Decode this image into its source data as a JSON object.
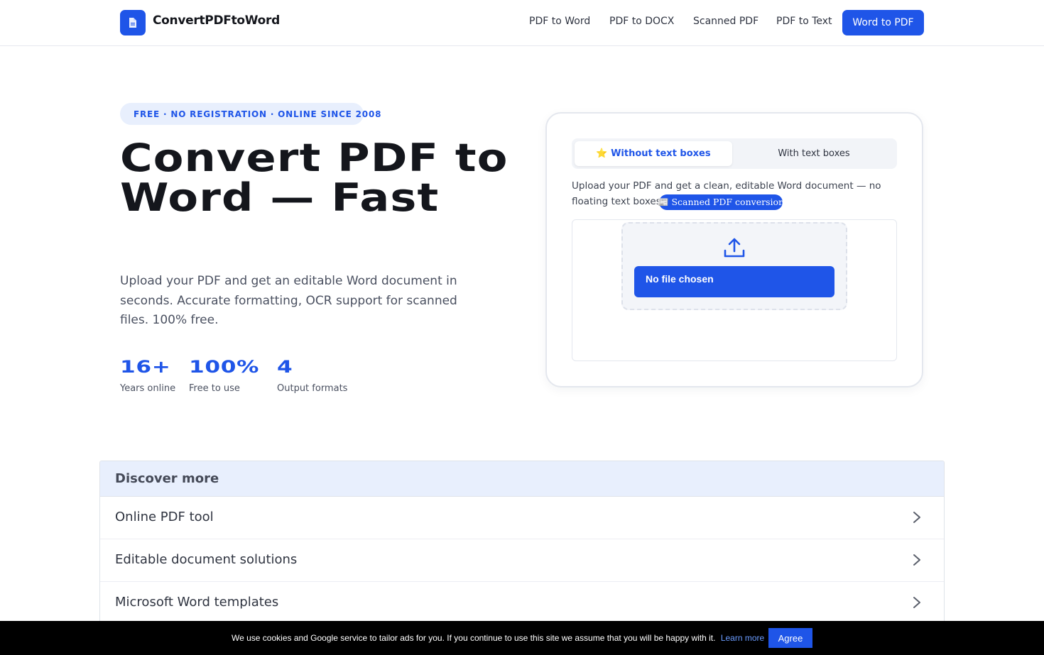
{
  "header": {
    "brand": "ConvertPDFtoWord",
    "logo_icon": "document-icon",
    "nav": [
      "PDF to Word",
      "PDF to DOCX",
      "Scanned PDF",
      "PDF to Text"
    ],
    "cta": "Word to PDF"
  },
  "hero": {
    "badge": "FREE · NO REGISTRATION · ONLINE SINCE 2008",
    "title": "Convert PDF to Word — Fast",
    "subtitle": "Upload your PDF and get an editable Word document in seconds. Accurate formatting, OCR support for scanned files. 100% free.",
    "stats": [
      {
        "value": "16+",
        "label": "Years online"
      },
      {
        "value": "100%",
        "label": "Free to use"
      },
      {
        "value": "4",
        "label": "Output formats"
      }
    ]
  },
  "converter": {
    "tabs": [
      {
        "label": "⭐ Without text boxes",
        "active": true
      },
      {
        "label": "With text boxes",
        "active": false
      }
    ],
    "description": "Upload your PDF and get a clean, editable Word document — no floating text boxes.",
    "scanned_link": "📰 Scanned PDF conversion",
    "upload_icon": "upload-icon",
    "file_button": "No file chosen"
  },
  "discover": {
    "heading": "Discover more",
    "items": [
      "Online PDF tool",
      "Editable document solutions",
      "Microsoft Word templates"
    ]
  },
  "cookie": {
    "text": "We use cookies and Google service to tailor ads for you. If you continue to use this site we assume that you will be happy with it.",
    "learn_more": "Learn more",
    "agree": "Agree"
  },
  "colors": {
    "accent": "#1f55e8",
    "badge_bg": "#e8effd",
    "cookie_bg": "#000000"
  }
}
